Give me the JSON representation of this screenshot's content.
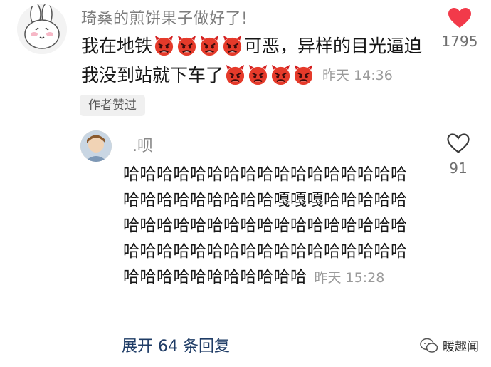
{
  "comment": {
    "username": "琦桑的煎饼果子做好了!",
    "line1_before": "我在地铁",
    "line1_after": "可恶，异样的目光逼迫",
    "line2_before": "我没到站就下车了",
    "emoji": "angry-devil-emoji",
    "time": "昨天 14:36",
    "badge": "作者赞过",
    "likes": "1795",
    "like_color": "#f23a4a"
  },
  "reply": {
    "username": ".呗",
    "text": "哈哈哈哈哈哈哈哈哈哈哈哈哈哈哈哈哈哈哈哈哈哈哈哈哈哈嘎嘎嘎哈哈哈哈哈哈哈哈哈哈哈哈哈哈哈哈哈哈哈哈哈哈哈哈哈哈哈哈哈哈哈哈哈哈哈哈哈哈哈哈哈哈哈哈哈哈哈哈哈哈",
    "time": "昨天 15:28",
    "likes": "91"
  },
  "expand_label": "展开 64 条回复",
  "watermark": "暖趣闻"
}
